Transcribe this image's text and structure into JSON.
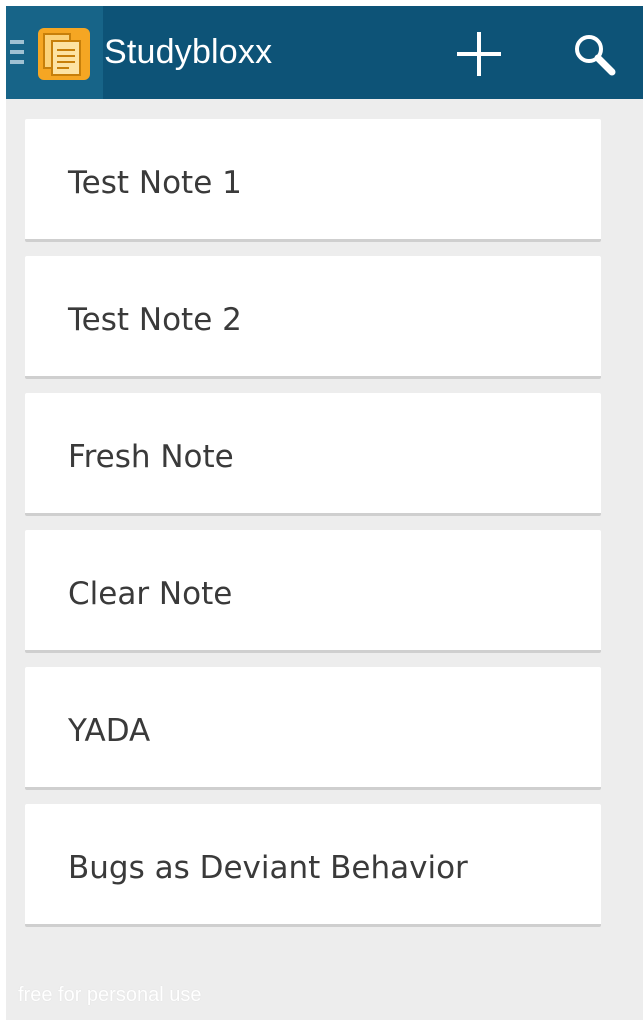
{
  "app_bar": {
    "title": "Studybloxx",
    "logo_icon": "notes-app-icon",
    "add_icon": "plus-icon",
    "search_icon": "search-icon",
    "background_color": "#0d5377"
  },
  "notes": [
    {
      "title": "Test Note 1"
    },
    {
      "title": "Test Note 2"
    },
    {
      "title": "Fresh Note"
    },
    {
      "title": "Clear Note"
    },
    {
      "title": "YADA"
    },
    {
      "title": "Bugs as Deviant Behavior"
    }
  ],
  "footer": {
    "text": "free for personal use"
  }
}
